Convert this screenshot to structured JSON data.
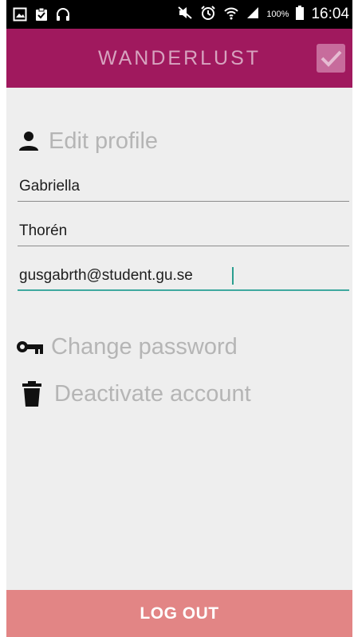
{
  "status_bar": {
    "battery": "100%",
    "time": "16:04"
  },
  "app_bar": {
    "title": "WANDERLUST",
    "save_icon": "check-box-icon",
    "accent_color": "#a0195e"
  },
  "profile": {
    "section_title": "Edit profile",
    "section_icon": "person-icon",
    "fields": {
      "first_name": "Gabriella",
      "last_name": "Thorén",
      "email": "gusgabrth@student.gu.se"
    }
  },
  "menu": {
    "change_password": "Change password",
    "change_password_icon": "key-icon",
    "deactivate_account": "Deactivate account",
    "deactivate_account_icon": "trash-icon"
  },
  "logout": {
    "label": "LOG OUT",
    "color": "#e28585"
  }
}
